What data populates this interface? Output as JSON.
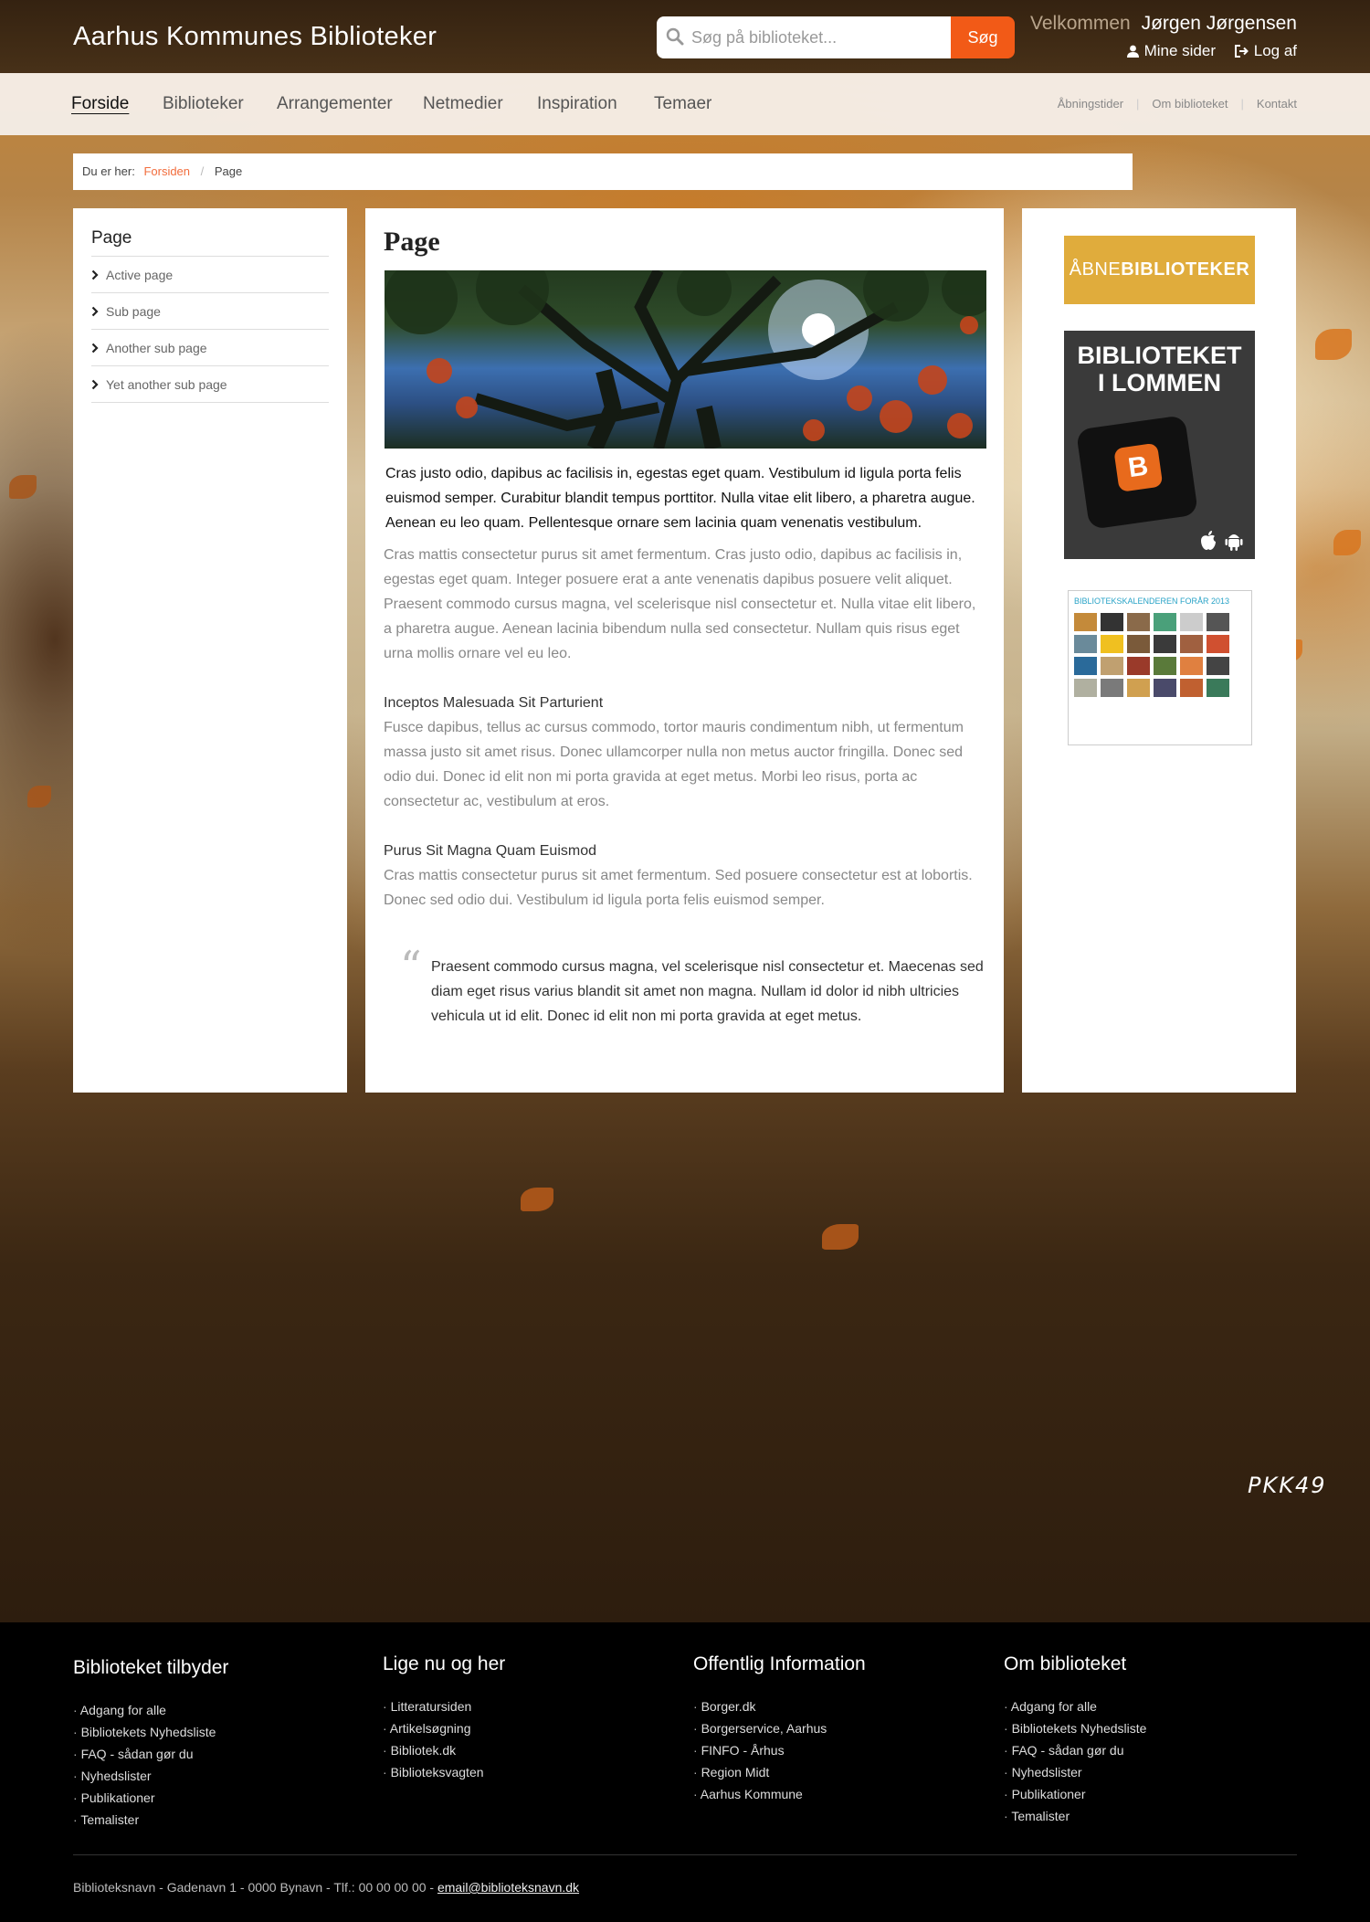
{
  "header": {
    "site_title": "Aarhus Kommunes Biblioteker",
    "search_placeholder": "Søg på biblioteket...",
    "search_button": "Søg",
    "welcome_label": "Velkommen",
    "user_name": "Jørgen Jørgensen",
    "my_pages": "Mine sider",
    "logout": "Log af"
  },
  "nav": {
    "items": [
      "Forside",
      "Biblioteker",
      "Arrangementer",
      "Netmedier",
      "Inspiration",
      "Temaer"
    ],
    "util": [
      "Åbningstider",
      "Om biblioteket",
      "Kontakt"
    ]
  },
  "breadcrumb": {
    "label": "Du er her:",
    "home": "Forsiden",
    "current": "Page"
  },
  "sidebar": {
    "title": "Page",
    "items": [
      "Active page",
      "Sub page",
      "Another sub page",
      "Yet another sub page"
    ]
  },
  "main": {
    "title": "Page",
    "lead": "Cras justo odio, dapibus ac facilisis in, egestas eget quam. Vestibulum id ligula porta felis euismod semper. Curabitur blandit tempus porttitor. Nulla vitae elit libero, a pharetra augue. Aenean eu leo quam. Pellentesque ornare sem lacinia quam venenatis vestibulum.",
    "para1": "Cras mattis consectetur purus sit amet fermentum. Cras justo odio, dapibus ac facilisis in, egestas eget quam. Integer posuere erat a ante venenatis dapibus posuere velit aliquet. Praesent commodo cursus magna, vel scelerisque nisl consectetur et. Nulla vitae elit libero, a pharetra augue. Aenean lacinia bibendum nulla sed consectetur. Nullam quis risus eget urna mollis ornare vel eu leo.",
    "heading2": "Inceptos Malesuada Sit Parturient",
    "para2": "Fusce dapibus, tellus ac cursus commodo, tortor mauris condimentum nibh, ut fermentum massa justo sit amet risus. Donec ullamcorper nulla non metus auctor fringilla. Donec sed odio dui. Donec id elit non mi porta gravida at eget metus. Morbi leo risus, porta ac consectetur ac, vestibulum at eros.",
    "heading3": "Purus Sit Magna Quam Euismod",
    "para3": "Cras mattis consectetur purus sit amet fermentum. Sed posuere consectetur est at lobortis. Donec sed odio dui. Vestibulum id ligula porta felis euismod semper.",
    "quote_mark": "“",
    "quote": "Praesent commodo cursus magna, vel scelerisque nisl consectetur et. Maecenas sed diam eget risus varius blandit sit amet non magna. Nullam id dolor id nibh ultricies vehicula ut id elit. Donec id elit non mi porta gravida at eget metus."
  },
  "promos": {
    "open_light": "ÅBNE",
    "open_bold": "BIBLIOTEKER",
    "pocket_line1": "BIBLIOTEKET",
    "pocket_line2": "I LOMMEN",
    "pocket_app_letter": "B",
    "calendar_title": "BIBLIOTEKSKALENDEREN FORÅR 2013"
  },
  "watermark": "PKK49",
  "footer": {
    "columns": [
      {
        "title": "Biblioteket tilbyder",
        "items": [
          "Adgang for alle",
          "Bibliotekets Nyhedsliste",
          "FAQ - sådan gør du",
          "Nyhedslister",
          "Publikationer",
          "Temalister"
        ]
      },
      {
        "title": "Lige nu og her",
        "items": [
          "Litteratursiden",
          "Artikelsøgning",
          "Bibliotek.dk",
          "Biblioteksvagten"
        ]
      },
      {
        "title": "Offentlig Information",
        "items": [
          "Borger.dk",
          "Borgerservice, Aarhus",
          "FINFO - Århus",
          "Region Midt",
          "Aarhus Kommune"
        ]
      },
      {
        "title": "Om biblioteket",
        "items": [
          "Adgang for alle",
          "Bibliotekets Nyhedsliste",
          "FAQ - sådan gør du",
          "Nyhedslister",
          "Publikationer",
          "Temalister"
        ]
      }
    ],
    "address": "Biblioteksnavn - Gadenavn 1 - 0000 Bynavn - Tlf.: 00 00 00 00 -",
    "email": "email@biblioteksnavn.dk"
  },
  "colors": {
    "accent": "#f25a17",
    "breadcrumb_link": "#f26d3d",
    "open_libraries": "#e0ac3c"
  }
}
